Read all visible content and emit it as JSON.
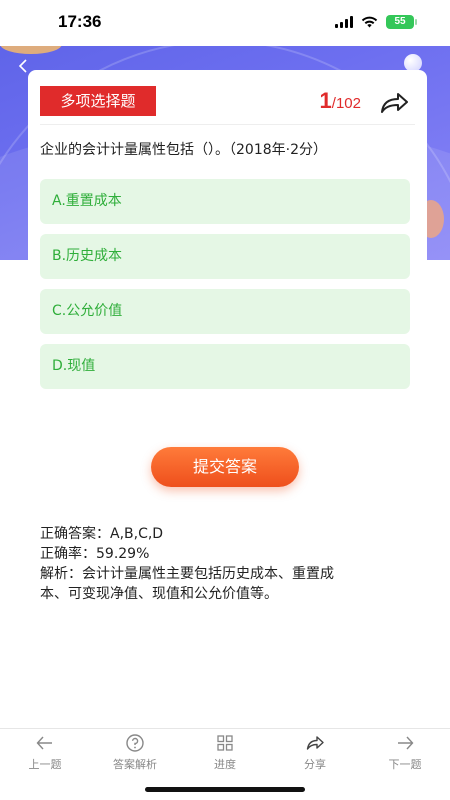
{
  "status_bar": {
    "time": "17:36",
    "battery": "55"
  },
  "question_card": {
    "type_label": "多项选择题",
    "current_index": "1",
    "total_label": "/102",
    "question_text": "企业的会计计量属性包括（）。（2018年·2分）"
  },
  "options": [
    {
      "label": "A.重置成本"
    },
    {
      "label": "B.历史成本"
    },
    {
      "label": "C.公允价值"
    },
    {
      "label": "D.现值"
    }
  ],
  "submit_label": "提交答案",
  "result": {
    "correct_answer": "正确答案：A,B,C,D",
    "accuracy": "正确率：59.29%",
    "analysis_line1": "解析：会计计量属性主要包括历史成本、重置成",
    "analysis_line2": "本、可变现净值、现值和公允价值等。"
  },
  "bottom_nav": {
    "prev": "上一题",
    "analysis": "答案解析",
    "progress": "进度",
    "share": "分享",
    "next": "下一题"
  },
  "colors": {
    "accent_red": "#e02b2b",
    "option_green": "#2fae3a",
    "option_bg": "#e5f7e5",
    "submit_orange": "#ee4f1c",
    "header_purple": "#6d6ff0"
  }
}
